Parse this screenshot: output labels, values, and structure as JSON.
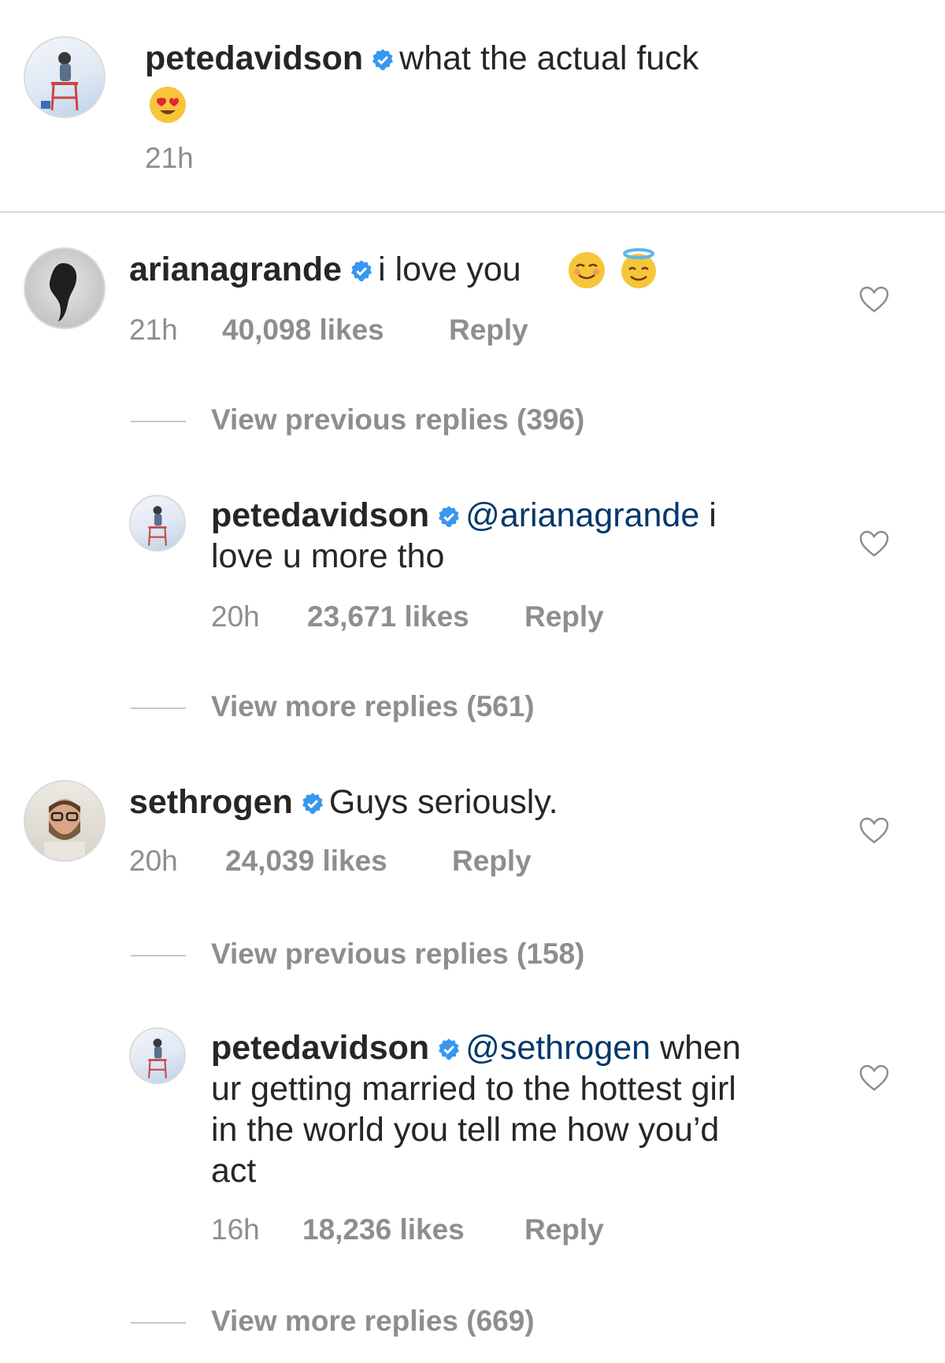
{
  "caption": {
    "username": "petedavidson",
    "text": "what the actual fuck",
    "emoji": "heart-eyes-emoji",
    "time": "21h"
  },
  "comments": [
    {
      "username": "arianagrande",
      "text": "i love you",
      "emojis": [
        "relieved-emoji",
        "halo-smile-emoji"
      ],
      "time": "21h",
      "likes": "40,098 likes",
      "reply": "Reply",
      "view_replies": "View previous replies (396)",
      "reply_item": {
        "username": "petedavidson",
        "mention": "@arianagrande",
        "text_line1": " i",
        "text_line2": "love u more tho",
        "time": "20h",
        "likes": "23,671 likes",
        "reply": "Reply"
      },
      "view_more": "View more replies (561)"
    },
    {
      "username": "sethrogen",
      "text": "Guys seriously.",
      "time": "20h",
      "likes": "24,039 likes",
      "reply": "Reply",
      "view_replies": "View previous replies (158)",
      "reply_item": {
        "username": "petedavidson",
        "mention": "@sethrogen",
        "text_line1": " when",
        "text_line2": "ur getting married to the hottest girl",
        "text_line3": "in the world you tell me how you’d",
        "text_line4": "act",
        "time": "16h",
        "likes": "18,236 likes",
        "reply": "Reply"
      },
      "view_more": "View more replies (669)"
    }
  ],
  "colors": {
    "verified": "#3897f0",
    "secondary_text": "#8e8e8e",
    "mention": "#00376b"
  }
}
